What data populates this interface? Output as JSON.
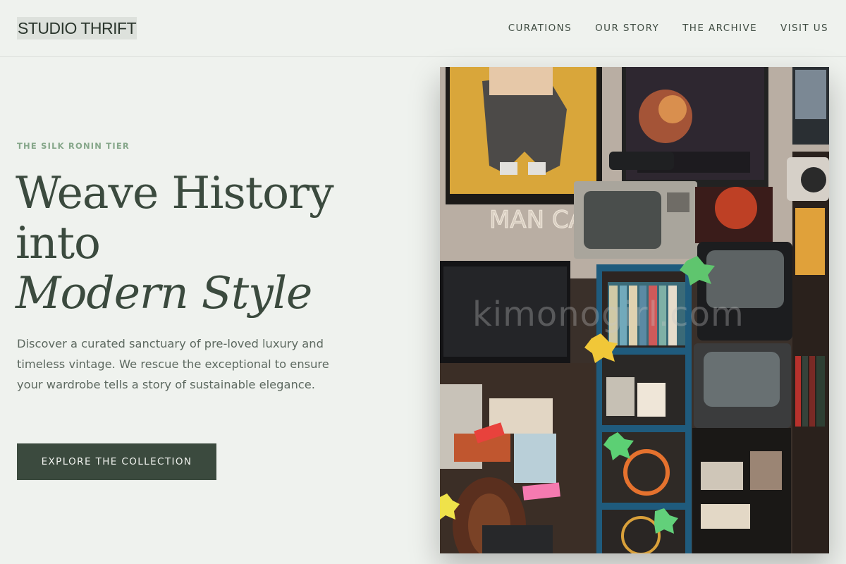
{
  "brand": {
    "name": "STUDIO THRIFT"
  },
  "nav": {
    "items": [
      {
        "label": "CURATIONS"
      },
      {
        "label": "OUR STORY"
      },
      {
        "label": "THE ARCHIVE"
      },
      {
        "label": "VISIT US"
      }
    ]
  },
  "hero": {
    "eyebrow": "THE SILK RONIN TIER",
    "headline_line1": "Weave History",
    "headline_line2": "into",
    "headline_line3": "Modern Style",
    "description": "Discover a curated sanctuary of pre-loved luxury and timeless vintage. We rescue the exceptional to ensure your wardrobe tells a story of sustainable elegance.",
    "cta_label": "EXPLORE THE COLLECTION",
    "image_watermark": "kimonogirl.com",
    "image_neon_sign": "MAN CAVE"
  },
  "colors": {
    "background": "#eff2ee",
    "primary": "#3b4a3e",
    "eyebrow": "#86a78a",
    "body_text": "#5d6960"
  }
}
